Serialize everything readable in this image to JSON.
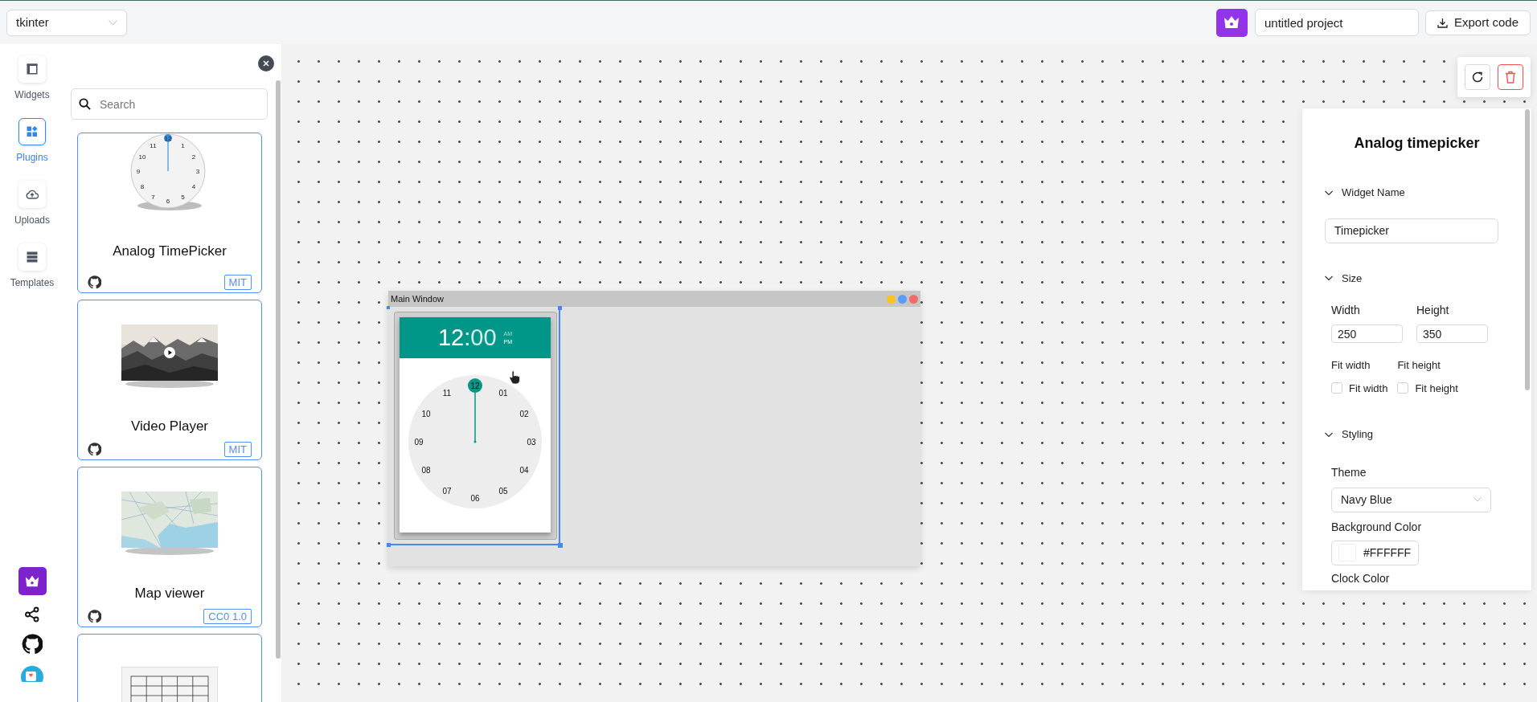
{
  "framework_select": {
    "value": "tkinter"
  },
  "project": {
    "name": "untitled project"
  },
  "export_button": {
    "label": "Export code"
  },
  "nav": [
    {
      "label": "Widgets",
      "selected": false
    },
    {
      "label": "Plugins",
      "selected": true
    },
    {
      "label": "Uploads",
      "selected": false
    },
    {
      "label": "Templates",
      "selected": false
    }
  ],
  "search": {
    "placeholder": "Search"
  },
  "plugins": [
    {
      "kind": "clock",
      "title": "Analog TimePicker",
      "license": "MIT",
      "clock_numbers": [
        "12",
        "1",
        "2",
        "3",
        "4",
        "5",
        "6",
        "7",
        "8",
        "9",
        "10",
        "11"
      ]
    },
    {
      "kind": "video",
      "title": "Video Player",
      "license": "MIT"
    },
    {
      "kind": "map",
      "title": "Map viewer",
      "license": "CC0 1.0"
    },
    {
      "kind": "table"
    }
  ],
  "canvas_window": {
    "title": "Main Window"
  },
  "timepicker": {
    "hour": "12",
    "separator": ":",
    "minute": "00",
    "periods": [
      {
        "label": "AM",
        "selected": false
      },
      {
        "label": "PM",
        "selected": true
      }
    ],
    "numbers": [
      {
        "label": "12",
        "selected": true
      },
      {
        "label": "01",
        "selected": false
      },
      {
        "label": "02",
        "selected": false
      },
      {
        "label": "03",
        "selected": false
      },
      {
        "label": "04",
        "selected": false
      },
      {
        "label": "05",
        "selected": false
      },
      {
        "label": "06",
        "selected": false
      },
      {
        "label": "07",
        "selected": false
      },
      {
        "label": "08",
        "selected": false
      },
      {
        "label": "09",
        "selected": false
      },
      {
        "label": "10",
        "selected": false
      },
      {
        "label": "11",
        "selected": false
      }
    ]
  },
  "properties": {
    "title": "Analog timepicker",
    "widget_name": {
      "heading": "Widget Name",
      "expanded": true,
      "value": "Timepicker"
    },
    "size": {
      "heading": "Size",
      "expanded": true,
      "width_label": "Width",
      "width_value": "250",
      "height_label": "Height",
      "height_value": "350",
      "fits": [
        {
          "label": "Fit width",
          "option": "Fit width",
          "checked": false
        },
        {
          "label": "Fit height",
          "option": "Fit height",
          "checked": false
        }
      ]
    },
    "styling": {
      "heading": "Styling",
      "expanded": true,
      "theme_label": "Theme",
      "theme_value": "Navy Blue",
      "background_label": "Background Color",
      "background_value": "#FFFFFF",
      "clock_color_label": "Clock Color"
    }
  }
}
